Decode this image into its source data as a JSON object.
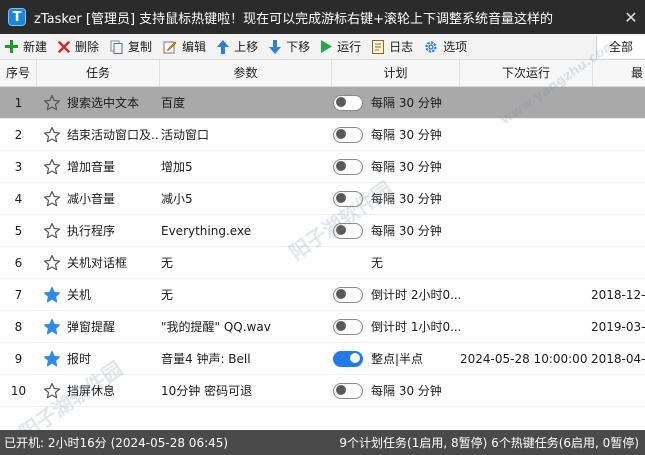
{
  "window": {
    "title": "zTasker [管理员]   支持鼠标热键啦！现在可以完成游标右键+滚轮上下调整系统音量这样的",
    "app_icon_letter": "T",
    "close_glyph": "✕"
  },
  "toolbar": {
    "new": "新建",
    "delete": "删除",
    "copy": "复制",
    "edit": "编辑",
    "up": "上移",
    "down": "下移",
    "run": "运行",
    "log": "日志",
    "options": "选项",
    "all": "全部"
  },
  "columns": {
    "no": "序号",
    "task": "任务",
    "param": "参数",
    "plan": "计划",
    "next": "下次运行",
    "last": "最"
  },
  "rows": [
    {
      "no": "1",
      "starred": false,
      "name": "搜索选中文本",
      "param": "百度",
      "has_toggle": true,
      "toggle_on": false,
      "plan": "每隔 30 分钟",
      "next": "",
      "last": "",
      "selected": true
    },
    {
      "no": "2",
      "starred": false,
      "name": "结束活动窗口及...",
      "param": "活动窗口",
      "has_toggle": true,
      "toggle_on": false,
      "plan": "每隔 30 分钟",
      "next": "",
      "last": "",
      "selected": false
    },
    {
      "no": "3",
      "starred": false,
      "name": "增加音量",
      "param": "增加5",
      "has_toggle": true,
      "toggle_on": false,
      "plan": "每隔 30 分钟",
      "next": "",
      "last": "",
      "selected": false
    },
    {
      "no": "4",
      "starred": false,
      "name": "减小音量",
      "param": "减小5",
      "has_toggle": true,
      "toggle_on": false,
      "plan": "每隔 30 分钟",
      "next": "",
      "last": "",
      "selected": false
    },
    {
      "no": "5",
      "starred": false,
      "name": "执行程序",
      "param": "Everything.exe",
      "has_toggle": true,
      "toggle_on": false,
      "plan": "每隔 30 分钟",
      "next": "",
      "last": "",
      "selected": false
    },
    {
      "no": "6",
      "starred": false,
      "name": "关机对话框",
      "param": "无",
      "has_toggle": false,
      "toggle_on": false,
      "plan": "无",
      "next": "",
      "last": "",
      "selected": false
    },
    {
      "no": "7",
      "starred": true,
      "name": "关机",
      "param": "无",
      "has_toggle": true,
      "toggle_on": false,
      "plan": "倒计时 2小时0...",
      "next": "",
      "last": "2018-12-",
      "selected": false
    },
    {
      "no": "8",
      "starred": true,
      "name": "弹窗提醒",
      "param": "\"我的提醒\" QQ.wav",
      "has_toggle": true,
      "toggle_on": false,
      "plan": "倒计时 1小时0...",
      "next": "",
      "last": "2019-03-",
      "selected": false
    },
    {
      "no": "9",
      "starred": true,
      "name": "报时",
      "param": "音量4 钟声: Bell",
      "has_toggle": true,
      "toggle_on": true,
      "plan": "整点|半点",
      "next": "2024-05-28 10:00:00",
      "last": "2018-04-",
      "selected": false
    },
    {
      "no": "10",
      "starred": false,
      "name": "挡屏休息",
      "param": "10分钟 密码可退",
      "has_toggle": true,
      "toggle_on": false,
      "plan": "每隔 30 分钟",
      "next": "",
      "last": "",
      "selected": false
    }
  ],
  "statusbar": {
    "left": "已开机: 2小时16分 (2024-05-28 06:45)",
    "right": "9个计划任务(1启用, 8暂停)   6个热键任务(6启用, 0暂停)"
  },
  "watermark": {
    "cn": "阳子湖软件园",
    "url": "www.yangzhu.com"
  },
  "colors": {
    "titlebar": "#2b2b2b",
    "accent_blue": "#1e7be8",
    "star_blue": "#2f8ae8",
    "selected_row": "#a9a9a9"
  }
}
